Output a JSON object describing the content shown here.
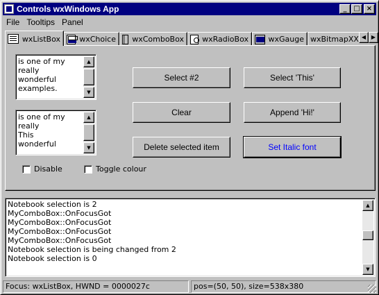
{
  "window": {
    "title": "Controls wxWindows App"
  },
  "titlebar_buttons": {
    "minimize": "_",
    "maximize": "□",
    "close": "×"
  },
  "menu": [
    "File",
    "Tooltips",
    "Panel"
  ],
  "tabs": [
    {
      "label": "wxListBox",
      "icon": "listbox-icon",
      "active": true
    },
    {
      "label": "wxChoice",
      "icon": "choice-icon"
    },
    {
      "label": "wxComboBox",
      "icon": "combobox-icon"
    },
    {
      "label": "wxRadioBox",
      "icon": "radiobox-icon"
    },
    {
      "label": "wxGauge",
      "icon": "gauge-icon"
    },
    {
      "label": "wxBitmapXX",
      "icon": ""
    }
  ],
  "listbox1": {
    "items": [
      "is one of my",
      "really",
      "wonderful",
      "examples."
    ]
  },
  "listbox2": {
    "items": [
      "is one of my",
      "really",
      "This",
      "wonderful"
    ]
  },
  "buttons": {
    "select2": "Select #2",
    "select_this": "Select 'This'",
    "clear": "Clear",
    "append": "Append 'Hi!'",
    "delete": "Delete selected item",
    "italic": "Set Italic font"
  },
  "checkboxes": {
    "disable": "Disable",
    "toggle_colour": "Toggle colour"
  },
  "log": [
    "Notebook selection is 2",
    "MyComboBox::OnFocusGot",
    "MyComboBox::OnFocusGot",
    "MyComboBox::OnFocusGot",
    "MyComboBox::OnFocusGot",
    "Notebook selection is being changed from 2",
    "Notebook selection is 0"
  ],
  "status": {
    "left": "Focus: wxListBox, HWND = 0000027c",
    "right": "pos=(50, 50), size=538x380"
  },
  "colors": {
    "title_bg": "#000080",
    "face": "#c0c0c0",
    "italic_button_text": "#0000ff"
  }
}
